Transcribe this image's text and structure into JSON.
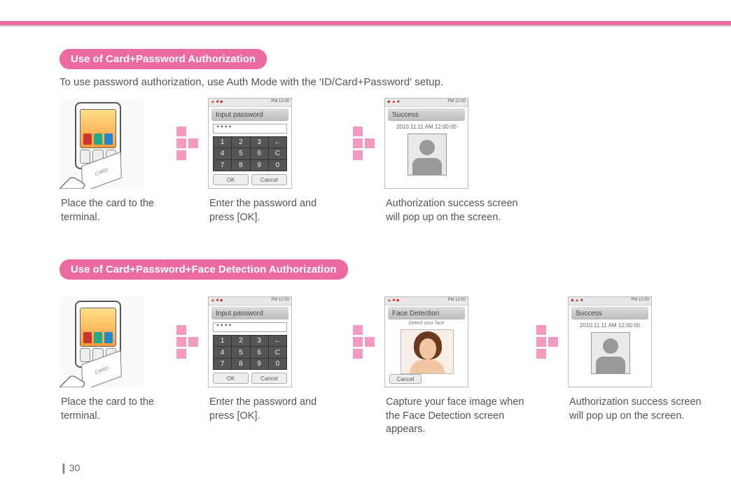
{
  "page_number": "30",
  "section1": {
    "title": "Use of Card+Password Authorization",
    "intro": "To use password authorization, use Auth Mode with the 'ID/Card+Password' setup.",
    "steps": [
      {
        "caption": "Place the card to the terminal."
      },
      {
        "caption": "Enter the password and press [OK]."
      },
      {
        "caption": "Authorization success screen will pop up on the screen."
      }
    ]
  },
  "section2": {
    "title": "Use of Card+Password+Face Detection Authorization",
    "steps": [
      {
        "caption": "Place the card to the terminal."
      },
      {
        "caption": "Enter the password and press [OK]."
      },
      {
        "caption": "Capture your face image when the Face Detection screen appears."
      },
      {
        "caption": "Authorization success screen will pop up on the screen."
      }
    ]
  },
  "screens": {
    "card_label": "CARD",
    "keypad": {
      "status_time": "PM 12:00",
      "title": "Input password",
      "masked": "****",
      "keys": [
        "1",
        "2",
        "3",
        "←",
        "4",
        "5",
        "6",
        "C",
        "7",
        "8",
        "9",
        "0"
      ],
      "ok": "OK",
      "cancel": "Cancel"
    },
    "success": {
      "title": "Success",
      "timestamp": "2010.11.11 AM 12:00:00"
    },
    "face": {
      "title": "Face Detection",
      "subtitle": "Detect your face",
      "cancel": "Cancel"
    }
  }
}
